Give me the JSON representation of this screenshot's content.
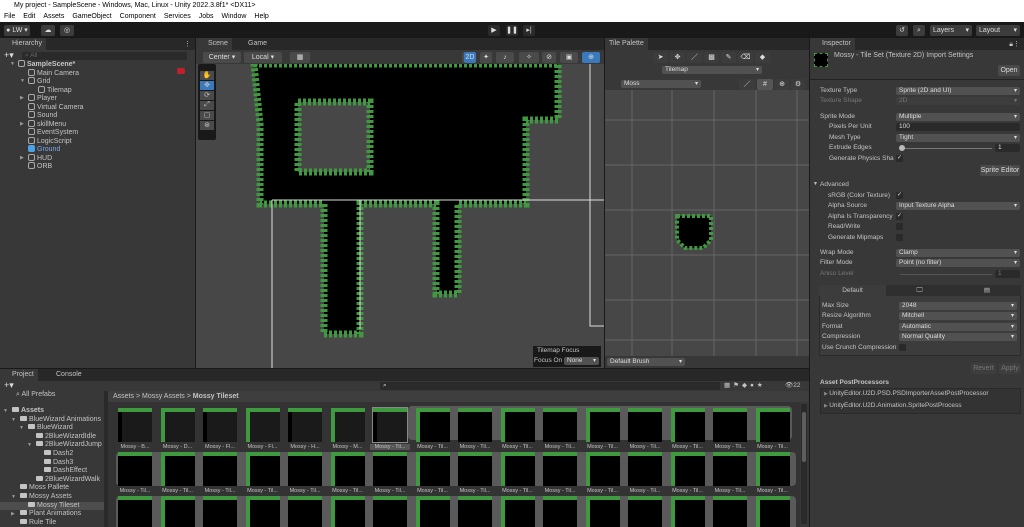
{
  "window": {
    "title": "My project - SampleScene - Windows, Mac, Linux - Unity 2022.3.8f1* <DX11>"
  },
  "menu": [
    "File",
    "Edit",
    "Assets",
    "GameObject",
    "Component",
    "Services",
    "Jobs",
    "Window",
    "Help"
  ],
  "toolbar": {
    "account": "LW",
    "layers": "Layers",
    "layout": "Layout"
  },
  "hierarchy": {
    "tab": "Hierarchy",
    "search_placeholder": "All",
    "items": [
      {
        "label": "SampleScene*",
        "depth": 0,
        "arrow": "▼",
        "bold": true
      },
      {
        "label": "Main Camera",
        "depth": 1,
        "arrow": ""
      },
      {
        "label": "Grid",
        "depth": 1,
        "arrow": "▼"
      },
      {
        "label": "Tilemap",
        "depth": 2,
        "arrow": ""
      },
      {
        "label": "Player",
        "depth": 1,
        "arrow": "▶"
      },
      {
        "label": "Virtual Camera",
        "depth": 1,
        "arrow": ""
      },
      {
        "label": "Sound",
        "depth": 1,
        "arrow": ""
      },
      {
        "label": "skillMenu",
        "depth": 1,
        "arrow": "▶"
      },
      {
        "label": "EventSystem",
        "depth": 1,
        "arrow": ""
      },
      {
        "label": "LogicScript",
        "depth": 1,
        "arrow": ""
      },
      {
        "label": "Ground",
        "depth": 1,
        "arrow": "",
        "selected": true
      },
      {
        "label": "HUD",
        "depth": 1,
        "arrow": "▶"
      },
      {
        "label": "ORB",
        "depth": 1,
        "arrow": ""
      }
    ]
  },
  "scene": {
    "tabs": [
      "Scene",
      "Game"
    ],
    "pivot": "Center",
    "space": "Local",
    "mode2d": "2D",
    "overlay_title": "Tilemap Focus",
    "focus_label": "Focus On",
    "focus_value": "None"
  },
  "tile_palette": {
    "tab": "Tile Palette",
    "target": "Tilemap",
    "palette": "Moss",
    "brush": "Default Brush"
  },
  "inspector": {
    "tab": "Inspector",
    "asset_title": "Mossy - Tile Set (Texture 2D) Import Settings",
    "open_btn": "Open",
    "texture_type_label": "Texture Type",
    "texture_type": "Sprite (2D and UI)",
    "texture_shape_label": "Texture Shape",
    "texture_shape": "2D",
    "sprite_mode_label": "Sprite Mode",
    "sprite_mode": "Multiple",
    "ppu_label": "Pixels Per Unit",
    "ppu": "100",
    "mesh_type_label": "Mesh Type",
    "mesh_type": "Tight",
    "extrude_label": "Extrude Edges",
    "extrude": "1",
    "gen_physics_label": "Generate Physics Sha",
    "sprite_editor_btn": "Sprite Editor",
    "advanced_label": "Advanced",
    "srgb_label": "sRGB (Color Texture)",
    "alpha_source_label": "Alpha Source",
    "alpha_source": "Input Texture Alpha",
    "alpha_transp_label": "Alpha Is Transparency",
    "readwrite_label": "Read/Write",
    "mipmaps_label": "Generate Mipmaps",
    "wrap_label": "Wrap Mode",
    "wrap": "Clamp",
    "filter_label": "Filter Mode",
    "filter": "Point (no filter)",
    "aniso_label": "Aniso Level",
    "aniso": "1",
    "platform_default": "Default",
    "max_size_label": "Max Size",
    "max_size": "2048",
    "resize_label": "Resize Algorithm",
    "resize": "Mitchell",
    "format_label": "Format",
    "format": "Automatic",
    "compression_label": "Compression",
    "compression": "Normal Quality",
    "crunch_label": "Use Crunch Compression",
    "revert_btn": "Revert",
    "apply_btn": "Apply",
    "postproc_label": "Asset PostProcessors",
    "postprocs": [
      "UnityEditor.U2D.PSD.PSDImporterAssetPostProcessor",
      "UnityEditor.U2D.Animation.SpritePostProcess"
    ]
  },
  "project": {
    "tabs": [
      "Project",
      "Console"
    ],
    "all_prefabs": "All Prefabs",
    "hidden_count": "22",
    "breadcrumb": [
      "Assets",
      "Mossy Assets",
      "Mossy Tileset"
    ],
    "tree": [
      {
        "label": "Assets",
        "depth": 0,
        "arrow": "▼",
        "bold": true
      },
      {
        "label": "BlueWizard Animations",
        "depth": 1,
        "arrow": "▼"
      },
      {
        "label": "BlueWizard",
        "depth": 2,
        "arrow": "▼"
      },
      {
        "label": "2BlueWizardIdle",
        "depth": 3,
        "arrow": ""
      },
      {
        "label": "2BlueWizardJump",
        "depth": 3,
        "arrow": "▼"
      },
      {
        "label": "Dash2",
        "depth": 4,
        "arrow": ""
      },
      {
        "label": "Dash3",
        "depth": 4,
        "arrow": ""
      },
      {
        "label": "DashEffect",
        "depth": 4,
        "arrow": ""
      },
      {
        "label": "2BlueWizardWalk",
        "depth": 3,
        "arrow": ""
      },
      {
        "label": "Moss Pallete",
        "depth": 1,
        "arrow": ""
      },
      {
        "label": "Mossy Assets",
        "depth": 1,
        "arrow": "▼"
      },
      {
        "label": "Mossy Tileset",
        "depth": 2,
        "arrow": "",
        "selected": true
      },
      {
        "label": "Plant Animations",
        "depth": 1,
        "arrow": "▶"
      },
      {
        "label": "Rule Tile",
        "depth": 1,
        "arrow": ""
      }
    ],
    "row1": [
      "Mossy - B...",
      "Mossy - D...",
      "Mossy - Fl...",
      "Mossy - Fl...",
      "Mossy - H...",
      "Mossy - M...",
      "Mossy - Til...",
      "Mossy - Til...",
      "Mossy - Til...",
      "Mossy - Til...",
      "Mossy - Til...",
      "Mossy - Til...",
      "Mossy - Til...",
      "Mossy - Til...",
      "Mossy - Til...",
      "Mossy - Til..."
    ],
    "row2": [
      "Mossy - Til...",
      "Mossy - Til...",
      "Mossy - Til...",
      "Mossy - Til...",
      "Mossy - Til...",
      "Mossy - Til...",
      "Mossy - Til...",
      "Mossy - Til...",
      "Mossy - Til...",
      "Mossy - Til...",
      "Mossy - Til...",
      "Mossy - Til...",
      "Mossy - Til...",
      "Mossy - Til...",
      "Mossy - Til...",
      "Mossy - Til..."
    ]
  },
  "colors": {
    "accent": "#3a79bb",
    "selected_text": "#7aa7e6",
    "moss": "#3f9a3f"
  }
}
